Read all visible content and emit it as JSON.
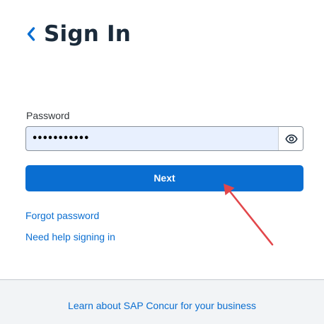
{
  "header": {
    "title": "Sign In",
    "back_icon": "chevron-left-icon"
  },
  "password": {
    "label": "Password",
    "value": "•••••••••••",
    "toggle_icon": "eye-icon"
  },
  "actions": {
    "next_label": "Next"
  },
  "links": {
    "forgot_password": "Forgot password",
    "help_signing_in": "Need help signing in"
  },
  "footer": {
    "link_text": "Learn about SAP Concur for your business"
  },
  "annotation": {
    "type": "red-arrow",
    "points_to": "next-button",
    "color": "#e2474b"
  },
  "colors": {
    "accent": "#0a6ed1",
    "title": "#1b2b3b",
    "input_bg": "#e8f0fe",
    "footer_bg": "#f2f4f6"
  }
}
